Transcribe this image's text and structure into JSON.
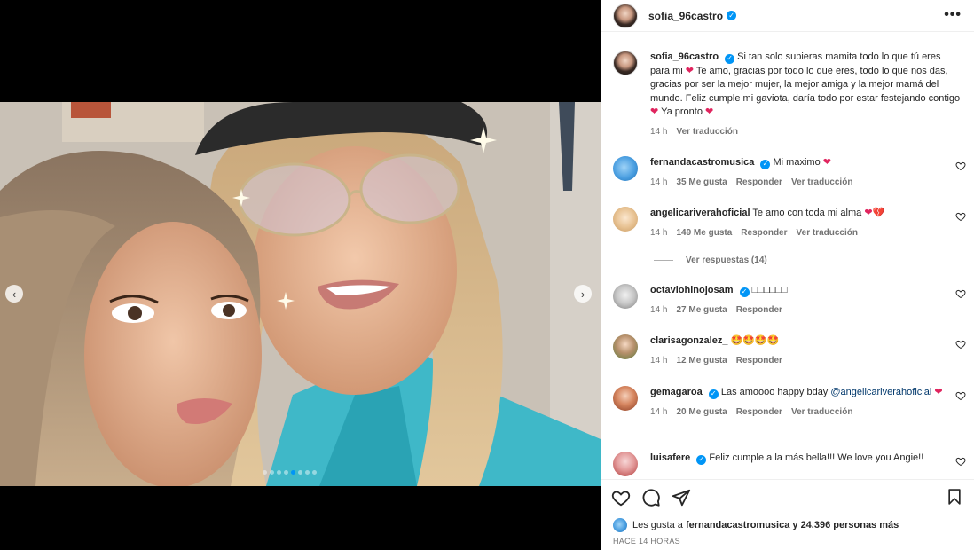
{
  "post": {
    "author": "sofia_96castro",
    "caption": "Si tan solo supieras mamita todo lo que tú eres para mi",
    "caption_2": "Te amo, gracias por todo lo que eres, todo lo que nos das, gracias por ser la mejor mujer, la mejor amiga y la mejor mamá del mundo. Feliz cumple mi gaviota, daría todo por estar festejando contigo",
    "caption_3": "Ya pronto",
    "caption_time": "14 h",
    "caption_translate": "Ver traducción",
    "heart": "❤",
    "carousel_prev": "‹",
    "carousel_next": "›",
    "more": "•••"
  },
  "comments": [
    {
      "user": "fernandacastromusica",
      "verified": true,
      "text": "Mi maximo",
      "time": "14 h",
      "likes": "35 Me gusta",
      "reply": "Responder",
      "translate": "Ver traducción"
    },
    {
      "user": "angelicariverahoficial",
      "verified": false,
      "text": "Te amo con toda mi alma",
      "time": "14 h",
      "likes": "149 Me gusta",
      "reply": "Responder",
      "translate": "Ver traducción"
    },
    {
      "user": "octaviohinojosam",
      "verified": true,
      "text": "□□□□□□",
      "time": "14 h",
      "likes": "27 Me gusta",
      "reply": "Responder"
    },
    {
      "user": "clarisagonzalez_",
      "verified": false,
      "text": "🤩🤩🤩🤩",
      "time": "14 h",
      "likes": "12 Me gusta",
      "reply": "Responder"
    },
    {
      "user": "gemagaroa",
      "verified": true,
      "text": "Las amoooo happy bday",
      "mention": "@angelicariverahoficial",
      "time": "14 h",
      "likes": "20 Me gusta",
      "reply": "Responder",
      "translate": "Ver traducción"
    },
    {
      "user": "luisafere",
      "verified": true,
      "text": "Feliz cumple a la más bella!!! We love you Angie!!"
    }
  ],
  "replies_link": "Ver respuestas (14)",
  "likes": {
    "prefix": "Les gusta a",
    "user": "fernandacastromusica",
    "suffix": "y 24.396 personas más"
  },
  "time_ago": "HACE 14 HORAS",
  "carousel": {
    "count": 8,
    "active": 4
  }
}
